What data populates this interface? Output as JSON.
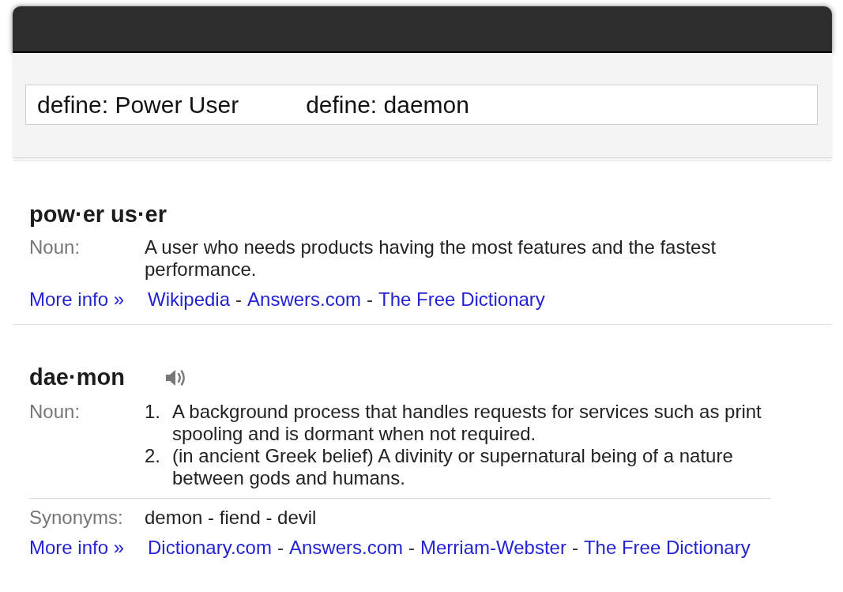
{
  "search": {
    "queries": [
      "define: Power User",
      "define: daemon"
    ]
  },
  "entries": [
    {
      "headword": "pow·er us·er",
      "audio": false,
      "part_of_speech": "Noun:",
      "definitions": [
        {
          "text": "A user who needs products having the most features and the fastest performance."
        }
      ],
      "more_info": {
        "label": "More info »",
        "separator": "-",
        "links": [
          "Wikipedia",
          "Answers.com",
          "The Free Dictionary"
        ]
      }
    },
    {
      "headword": "dae·mon",
      "audio": true,
      "part_of_speech": "Noun:",
      "definitions": [
        {
          "number": "1.",
          "text": "A background process that handles requests for services such as print spooling and is dormant when not required."
        },
        {
          "number": "2.",
          "text": "(in ancient Greek belief) A divinity or supernatural being of a nature between gods and humans."
        }
      ],
      "synonyms": {
        "label": "Synonyms:",
        "text": "demon - fiend - devil"
      },
      "more_info": {
        "label": "More info »",
        "separator": "-",
        "links": [
          "Dictionary.com",
          "Answers.com",
          "Merriam-Webster",
          "The Free Dictionary"
        ]
      }
    }
  ]
}
